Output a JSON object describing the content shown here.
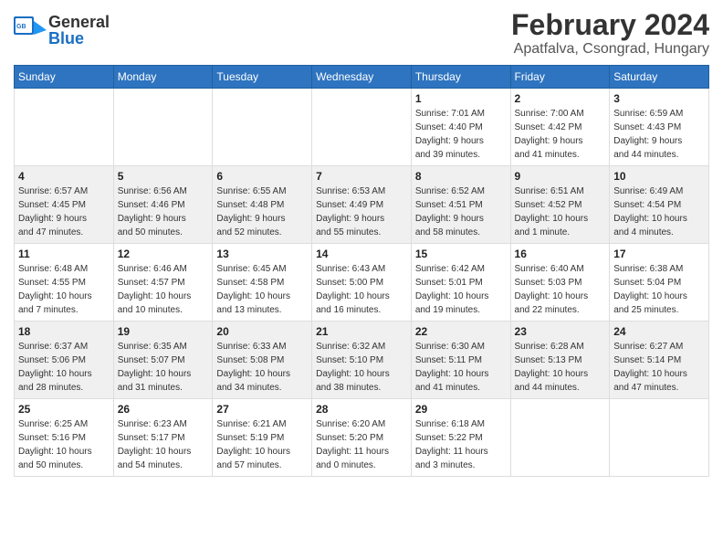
{
  "header": {
    "logo_general": "General",
    "logo_blue": "Blue",
    "month_year": "February 2024",
    "location": "Apatfalva, Csongrad, Hungary"
  },
  "weekdays": [
    "Sunday",
    "Monday",
    "Tuesday",
    "Wednesday",
    "Thursday",
    "Friday",
    "Saturday"
  ],
  "weeks": [
    [
      {
        "day": "",
        "info": ""
      },
      {
        "day": "",
        "info": ""
      },
      {
        "day": "",
        "info": ""
      },
      {
        "day": "",
        "info": ""
      },
      {
        "day": "1",
        "info": "Sunrise: 7:01 AM\nSunset: 4:40 PM\nDaylight: 9 hours\nand 39 minutes."
      },
      {
        "day": "2",
        "info": "Sunrise: 7:00 AM\nSunset: 4:42 PM\nDaylight: 9 hours\nand 41 minutes."
      },
      {
        "day": "3",
        "info": "Sunrise: 6:59 AM\nSunset: 4:43 PM\nDaylight: 9 hours\nand 44 minutes."
      }
    ],
    [
      {
        "day": "4",
        "info": "Sunrise: 6:57 AM\nSunset: 4:45 PM\nDaylight: 9 hours\nand 47 minutes."
      },
      {
        "day": "5",
        "info": "Sunrise: 6:56 AM\nSunset: 4:46 PM\nDaylight: 9 hours\nand 50 minutes."
      },
      {
        "day": "6",
        "info": "Sunrise: 6:55 AM\nSunset: 4:48 PM\nDaylight: 9 hours\nand 52 minutes."
      },
      {
        "day": "7",
        "info": "Sunrise: 6:53 AM\nSunset: 4:49 PM\nDaylight: 9 hours\nand 55 minutes."
      },
      {
        "day": "8",
        "info": "Sunrise: 6:52 AM\nSunset: 4:51 PM\nDaylight: 9 hours\nand 58 minutes."
      },
      {
        "day": "9",
        "info": "Sunrise: 6:51 AM\nSunset: 4:52 PM\nDaylight: 10 hours\nand 1 minute."
      },
      {
        "day": "10",
        "info": "Sunrise: 6:49 AM\nSunset: 4:54 PM\nDaylight: 10 hours\nand 4 minutes."
      }
    ],
    [
      {
        "day": "11",
        "info": "Sunrise: 6:48 AM\nSunset: 4:55 PM\nDaylight: 10 hours\nand 7 minutes."
      },
      {
        "day": "12",
        "info": "Sunrise: 6:46 AM\nSunset: 4:57 PM\nDaylight: 10 hours\nand 10 minutes."
      },
      {
        "day": "13",
        "info": "Sunrise: 6:45 AM\nSunset: 4:58 PM\nDaylight: 10 hours\nand 13 minutes."
      },
      {
        "day": "14",
        "info": "Sunrise: 6:43 AM\nSunset: 5:00 PM\nDaylight: 10 hours\nand 16 minutes."
      },
      {
        "day": "15",
        "info": "Sunrise: 6:42 AM\nSunset: 5:01 PM\nDaylight: 10 hours\nand 19 minutes."
      },
      {
        "day": "16",
        "info": "Sunrise: 6:40 AM\nSunset: 5:03 PM\nDaylight: 10 hours\nand 22 minutes."
      },
      {
        "day": "17",
        "info": "Sunrise: 6:38 AM\nSunset: 5:04 PM\nDaylight: 10 hours\nand 25 minutes."
      }
    ],
    [
      {
        "day": "18",
        "info": "Sunrise: 6:37 AM\nSunset: 5:06 PM\nDaylight: 10 hours\nand 28 minutes."
      },
      {
        "day": "19",
        "info": "Sunrise: 6:35 AM\nSunset: 5:07 PM\nDaylight: 10 hours\nand 31 minutes."
      },
      {
        "day": "20",
        "info": "Sunrise: 6:33 AM\nSunset: 5:08 PM\nDaylight: 10 hours\nand 34 minutes."
      },
      {
        "day": "21",
        "info": "Sunrise: 6:32 AM\nSunset: 5:10 PM\nDaylight: 10 hours\nand 38 minutes."
      },
      {
        "day": "22",
        "info": "Sunrise: 6:30 AM\nSunset: 5:11 PM\nDaylight: 10 hours\nand 41 minutes."
      },
      {
        "day": "23",
        "info": "Sunrise: 6:28 AM\nSunset: 5:13 PM\nDaylight: 10 hours\nand 44 minutes."
      },
      {
        "day": "24",
        "info": "Sunrise: 6:27 AM\nSunset: 5:14 PM\nDaylight: 10 hours\nand 47 minutes."
      }
    ],
    [
      {
        "day": "25",
        "info": "Sunrise: 6:25 AM\nSunset: 5:16 PM\nDaylight: 10 hours\nand 50 minutes."
      },
      {
        "day": "26",
        "info": "Sunrise: 6:23 AM\nSunset: 5:17 PM\nDaylight: 10 hours\nand 54 minutes."
      },
      {
        "day": "27",
        "info": "Sunrise: 6:21 AM\nSunset: 5:19 PM\nDaylight: 10 hours\nand 57 minutes."
      },
      {
        "day": "28",
        "info": "Sunrise: 6:20 AM\nSunset: 5:20 PM\nDaylight: 11 hours\nand 0 minutes."
      },
      {
        "day": "29",
        "info": "Sunrise: 6:18 AM\nSunset: 5:22 PM\nDaylight: 11 hours\nand 3 minutes."
      },
      {
        "day": "",
        "info": ""
      },
      {
        "day": "",
        "info": ""
      }
    ]
  ]
}
